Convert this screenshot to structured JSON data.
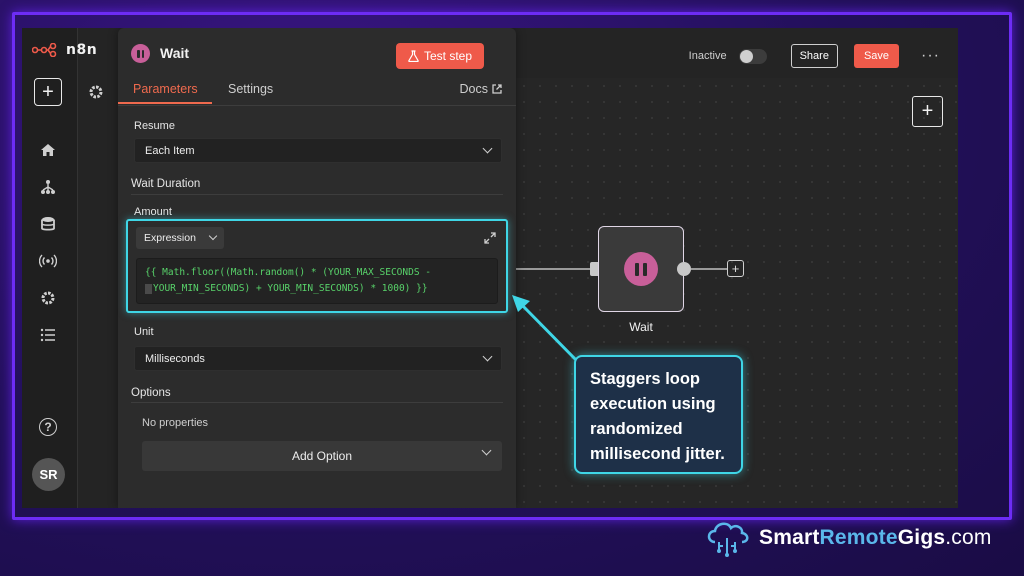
{
  "app": {
    "logo_text": "n8n",
    "status_label": "Inactive",
    "share_label": "Share",
    "save_label": "Save",
    "avatar_initials": "SR"
  },
  "panel": {
    "title": "Wait",
    "test_button_label": "Test step",
    "tabs": [
      {
        "label": "Parameters",
        "active": true
      },
      {
        "label": "Settings",
        "active": false
      }
    ],
    "docs_label": "Docs",
    "resume": {
      "label": "Resume",
      "value": "Each Item"
    },
    "wait_duration_label": "Wait Duration",
    "amount": {
      "label": "Amount",
      "mode": "Expression",
      "expression_line1": "{{ Math.floor((Math.random() * (YOUR_MAX_SECONDS -",
      "expression_line2": "YOUR_MIN_SECONDS) + YOUR_MIN_SECONDS) * 1000) }}"
    },
    "unit": {
      "label": "Unit",
      "value": "Milliseconds"
    },
    "options": {
      "label": "Options",
      "empty_text": "No properties",
      "add_label": "Add Option"
    }
  },
  "canvas": {
    "node_label": "Wait"
  },
  "callout": {
    "line1": "Staggers loop",
    "line2": "execution using",
    "line3": "randomized",
    "line4": "millisecond jitter."
  },
  "brand": {
    "part1": "Smart",
    "part2": "Remote",
    "part3": "Gigs",
    "part4": ".com"
  },
  "colors": {
    "accent": "#ef5a4a",
    "highlight": "#3fd6e6",
    "node_icon": "#c85f99",
    "frame": "#6d2cf5"
  }
}
